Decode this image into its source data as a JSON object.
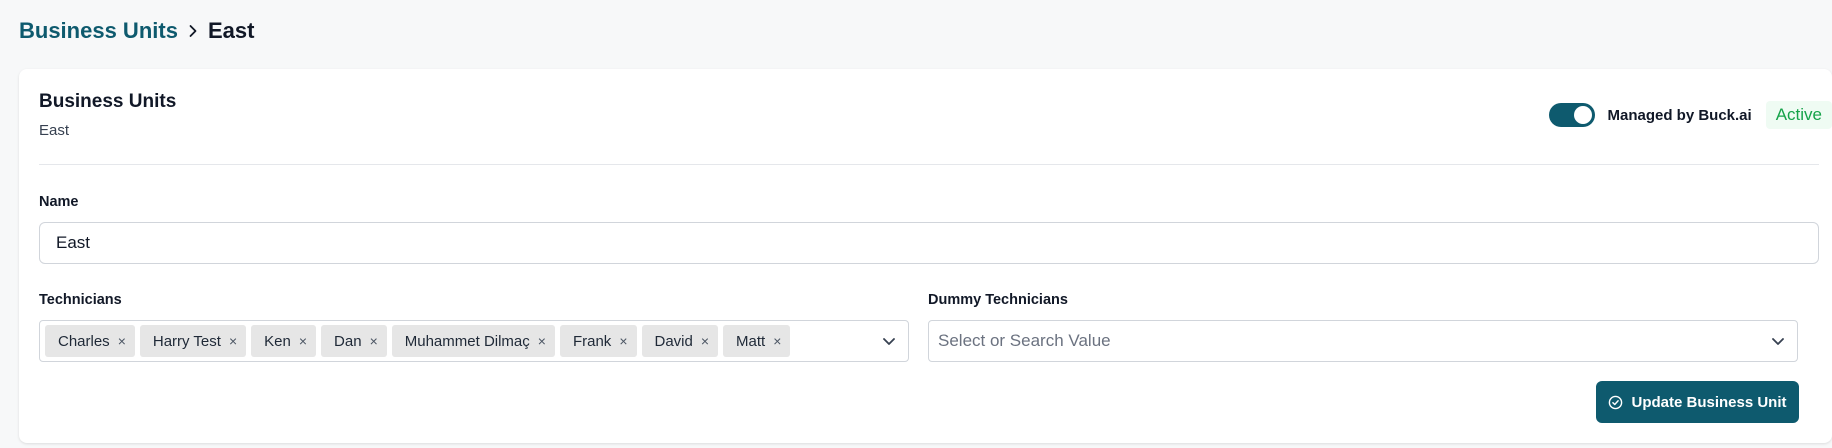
{
  "breadcrumb": {
    "parent": "Business Units",
    "current": "East"
  },
  "card": {
    "title": "Business Units",
    "subtitle": "East",
    "toggle_on": true,
    "managed_label": "Managed by Buck.ai",
    "status": "Active"
  },
  "form": {
    "name_label": "Name",
    "name_value": "East",
    "technicians_label": "Technicians",
    "technicians": [
      "Charles",
      "Harry Test",
      "Ken",
      "Dan",
      "Muhammet Dilmaç",
      "Frank",
      "David",
      "Matt"
    ],
    "dummy_label": "Dummy Technicians",
    "dummy_placeholder": "Select or Search Value",
    "submit_label": "Update Business Unit"
  },
  "colors": {
    "brand": "#0e5a6e",
    "active": "#16a34a"
  }
}
